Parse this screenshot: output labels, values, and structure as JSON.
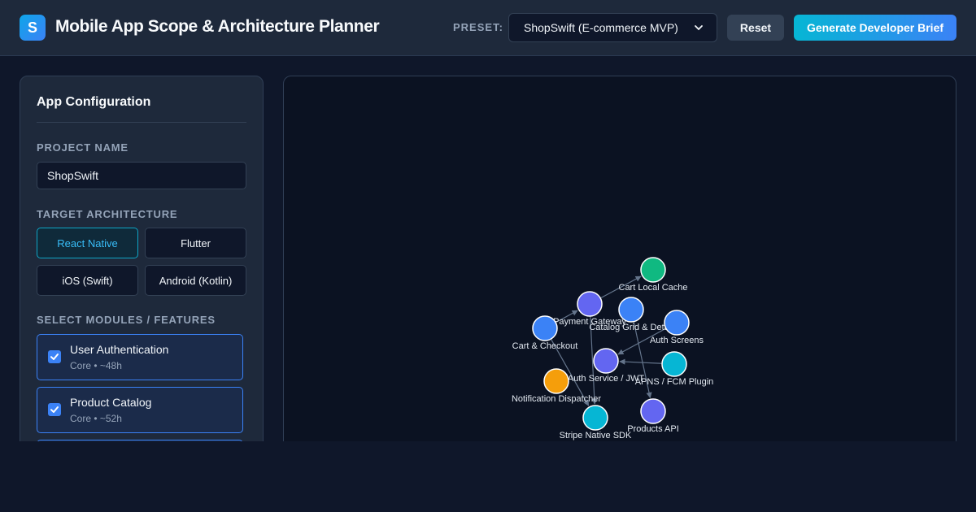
{
  "header": {
    "logo_letter": "S",
    "title": "Mobile App Scope & Architecture Planner",
    "preset_label": "PRESET:",
    "preset_value": "ShopSwift (E-commerce MVP)",
    "reset_label": "Reset",
    "generate_label": "Generate Developer Brief"
  },
  "config": {
    "title": "App Configuration",
    "project_name_label": "PROJECT NAME",
    "project_name_value": "ShopSwift",
    "architecture_label": "TARGET ARCHITECTURE",
    "architectures": [
      {
        "label": "React Native",
        "active": true
      },
      {
        "label": "Flutter",
        "active": false
      },
      {
        "label": "iOS (Swift)",
        "active": false
      },
      {
        "label": "Android (Kotlin)",
        "active": false
      }
    ],
    "modules_label": "SELECT MODULES / FEATURES",
    "modules": [
      {
        "name": "User Authentication",
        "meta": "Core • ~48h",
        "checked": true
      },
      {
        "name": "Product Catalog",
        "meta": "Core • ~52h",
        "checked": true
      }
    ]
  },
  "graph": {
    "colors": {
      "indigo": "#6366f1",
      "blue": "#3b82f6",
      "green": "#10b981",
      "cyan": "#06b6d4",
      "amber": "#f59e0b",
      "edge": "#64748b"
    },
    "nodes": [
      {
        "id": "cart_cache",
        "label": "Cart Local Cache",
        "color": "green"
      },
      {
        "id": "payment_gateway",
        "label": "Payment Gateway",
        "color": "indigo"
      },
      {
        "id": "catalog_grid",
        "label": "Catalog Grid & Detail",
        "color": "blue"
      },
      {
        "id": "auth_screens",
        "label": "Auth Screens",
        "color": "blue"
      },
      {
        "id": "cart_checkout",
        "label": "Cart & Checkout",
        "color": "blue"
      },
      {
        "id": "auth_service",
        "label": "Auth Service / JWT",
        "color": "indigo"
      },
      {
        "id": "apns_fcm",
        "label": "APNS / FCM Plugin",
        "color": "cyan"
      },
      {
        "id": "notification_dispatcher",
        "label": "Notification Dispatcher",
        "color": "amber"
      },
      {
        "id": "products_api",
        "label": "Products API",
        "color": "indigo"
      },
      {
        "id": "stripe_sdk",
        "label": "Stripe Native SDK",
        "color": "cyan"
      }
    ],
    "edges": [
      {
        "from": "payment_gateway",
        "to": "cart_cache"
      },
      {
        "from": "cart_checkout",
        "to": "payment_gateway"
      },
      {
        "from": "auth_screens",
        "to": "auth_service"
      },
      {
        "from": "catalog_grid",
        "to": "products_api"
      },
      {
        "from": "payment_gateway",
        "to": "stripe_sdk"
      },
      {
        "from": "cart_checkout",
        "to": "stripe_sdk"
      },
      {
        "from": "apns_fcm",
        "to": "auth_service"
      }
    ]
  }
}
